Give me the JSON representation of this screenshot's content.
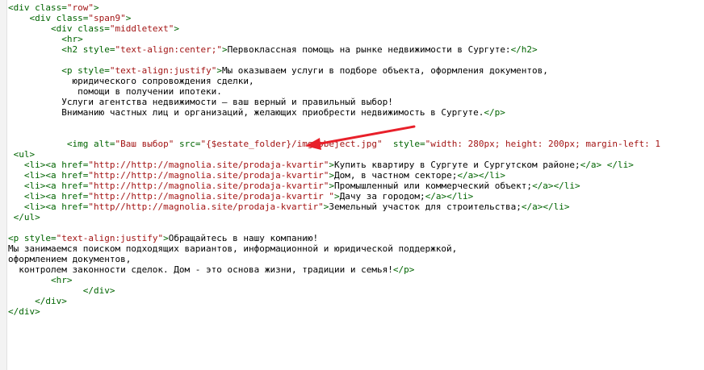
{
  "lines": [
    [
      [
        "tag",
        "<div "
      ],
      [
        "at",
        "class="
      ],
      [
        "str",
        "\"row\""
      ],
      [
        "tag",
        ">"
      ]
    ],
    [
      [
        "txt",
        "    "
      ],
      [
        "tag",
        "<div "
      ],
      [
        "at",
        "class="
      ],
      [
        "str",
        "\"span9\""
      ],
      [
        "tag",
        ">"
      ]
    ],
    [
      [
        "txt",
        "        "
      ],
      [
        "tag",
        "<div "
      ],
      [
        "at",
        "class="
      ],
      [
        "str",
        "\"middletext\""
      ],
      [
        "tag",
        ">"
      ]
    ],
    [
      [
        "txt",
        "          "
      ],
      [
        "tag",
        "<hr>"
      ]
    ],
    [
      [
        "txt",
        "          "
      ],
      [
        "tag",
        "<h2 "
      ],
      [
        "at",
        "style="
      ],
      [
        "str",
        "\"text-align:center;\""
      ],
      [
        "tag",
        ">"
      ],
      [
        "txt",
        "Первоклассная помощь на рынке недвижимости в Сургуте:"
      ],
      [
        "tag",
        "</h2>"
      ]
    ],
    [
      [
        "txt",
        ""
      ]
    ],
    [
      [
        "txt",
        "          "
      ],
      [
        "tag",
        "<p "
      ],
      [
        "at",
        "style="
      ],
      [
        "str",
        "\"text-align:justify\""
      ],
      [
        "tag",
        ">"
      ],
      [
        "txt",
        "Мы оказываем услуги в подборе объекта, оформления документов,"
      ]
    ],
    [
      [
        "txt",
        "            юридического сопровождения сделки,"
      ]
    ],
    [
      [
        "txt",
        "             помощи в получении ипотеки."
      ]
    ],
    [
      [
        "txt",
        "          Услуги агентства недвижимости — ваш верный и правильный выбор!"
      ]
    ],
    [
      [
        "txt",
        "          Вниманию частных лиц и организаций, желающих приобрести недвижимость в Сургуте."
      ],
      [
        "tag",
        "</p>"
      ]
    ],
    [
      [
        "txt",
        ""
      ]
    ],
    [
      [
        "txt",
        ""
      ]
    ],
    [
      [
        "txt",
        "           "
      ],
      [
        "tag",
        "<img "
      ],
      [
        "at",
        "alt="
      ],
      [
        "str",
        "\"Ваш выбор\""
      ],
      [
        "txt",
        " "
      ],
      [
        "at",
        "src="
      ],
      [
        "str",
        "\"{$estate_folder}/img/obeject.jpg\""
      ],
      [
        "txt",
        "  "
      ],
      [
        "at",
        "style="
      ],
      [
        "str",
        "\"width: 280px; height: 200px; margin-left: 1"
      ]
    ],
    [
      [
        "txt",
        " "
      ],
      [
        "tag",
        "<ul>"
      ]
    ],
    [
      [
        "txt",
        "   "
      ],
      [
        "tag",
        "<li>"
      ],
      [
        "tag",
        "<a "
      ],
      [
        "at",
        "href="
      ],
      [
        "str",
        "\"http://http://magnolia.site/prodaja-kvartir\""
      ],
      [
        "tag",
        ">"
      ],
      [
        "txt",
        "Купить квартиру в Сургуте и Сургутском районе;"
      ],
      [
        "tag",
        "</a>"
      ],
      [
        "txt",
        " "
      ],
      [
        "tag",
        "</li>"
      ]
    ],
    [
      [
        "txt",
        "   "
      ],
      [
        "tag",
        "<li>"
      ],
      [
        "tag",
        "<a "
      ],
      [
        "at",
        "href="
      ],
      [
        "str",
        "\"http://http://magnolia.site/prodaja-kvartir\""
      ],
      [
        "tag",
        ">"
      ],
      [
        "txt",
        "Дом, в частном секторе;"
      ],
      [
        "tag",
        "</a>"
      ],
      [
        "tag",
        "</li>"
      ]
    ],
    [
      [
        "txt",
        "   "
      ],
      [
        "tag",
        "<li>"
      ],
      [
        "tag",
        "<a "
      ],
      [
        "at",
        "href="
      ],
      [
        "str",
        "\"http://http://magnolia.site/prodaja-kvartir\""
      ],
      [
        "tag",
        ">"
      ],
      [
        "txt",
        "Промышленный или коммерческий объект;"
      ],
      [
        "tag",
        "</a>"
      ],
      [
        "tag",
        "</li>"
      ]
    ],
    [
      [
        "txt",
        "   "
      ],
      [
        "tag",
        "<li>"
      ],
      [
        "tag",
        "<a "
      ],
      [
        "at",
        "href="
      ],
      [
        "str",
        "\"http://http://magnolia.site/prodaja-kvartir \""
      ],
      [
        "tag",
        ">"
      ],
      [
        "txt",
        "Дачу за городом;"
      ],
      [
        "tag",
        "</a>"
      ],
      [
        "tag",
        "</li>"
      ]
    ],
    [
      [
        "txt",
        "   "
      ],
      [
        "tag",
        "<li>"
      ],
      [
        "tag",
        "<a "
      ],
      [
        "at",
        "href="
      ],
      [
        "str",
        "\"http//http://magnolia.site/prodaja-kvartir\""
      ],
      [
        "tag",
        ">"
      ],
      [
        "txt",
        "Земельный участок для строительства;"
      ],
      [
        "tag",
        "</a>"
      ],
      [
        "tag",
        "</li>"
      ]
    ],
    [
      [
        "txt",
        " "
      ],
      [
        "tag",
        "</ul>"
      ]
    ],
    [
      [
        "txt",
        ""
      ]
    ],
    [
      [
        "tag",
        "<p "
      ],
      [
        "at",
        "style="
      ],
      [
        "str",
        "\"text-align:justify\""
      ],
      [
        "tag",
        ">"
      ],
      [
        "txt",
        "Обращайтесь в нашу компанию!"
      ]
    ],
    [
      [
        "txt",
        "Мы занимаемся поиском подходящих вариантов, информационной и юридической поддержкой,"
      ]
    ],
    [
      [
        "txt",
        "оформлением документов,"
      ]
    ],
    [
      [
        "txt",
        "  контролем законности сделок. Дом - это основа жизни, традиции и семья!"
      ],
      [
        "tag",
        "</p>"
      ]
    ],
    [
      [
        "txt",
        "        "
      ],
      [
        "tag",
        "<hr>"
      ]
    ],
    [
      [
        "txt",
        "              "
      ],
      [
        "tag",
        "</div>"
      ]
    ],
    [
      [
        "txt",
        "     "
      ],
      [
        "tag",
        "</div>"
      ]
    ],
    [
      [
        "tag",
        "</div>"
      ]
    ]
  ],
  "colors": {
    "tag": "#006400",
    "attribute": "#006400",
    "string": "#a31515",
    "text": "#000000",
    "arrow": "#e8202a"
  }
}
